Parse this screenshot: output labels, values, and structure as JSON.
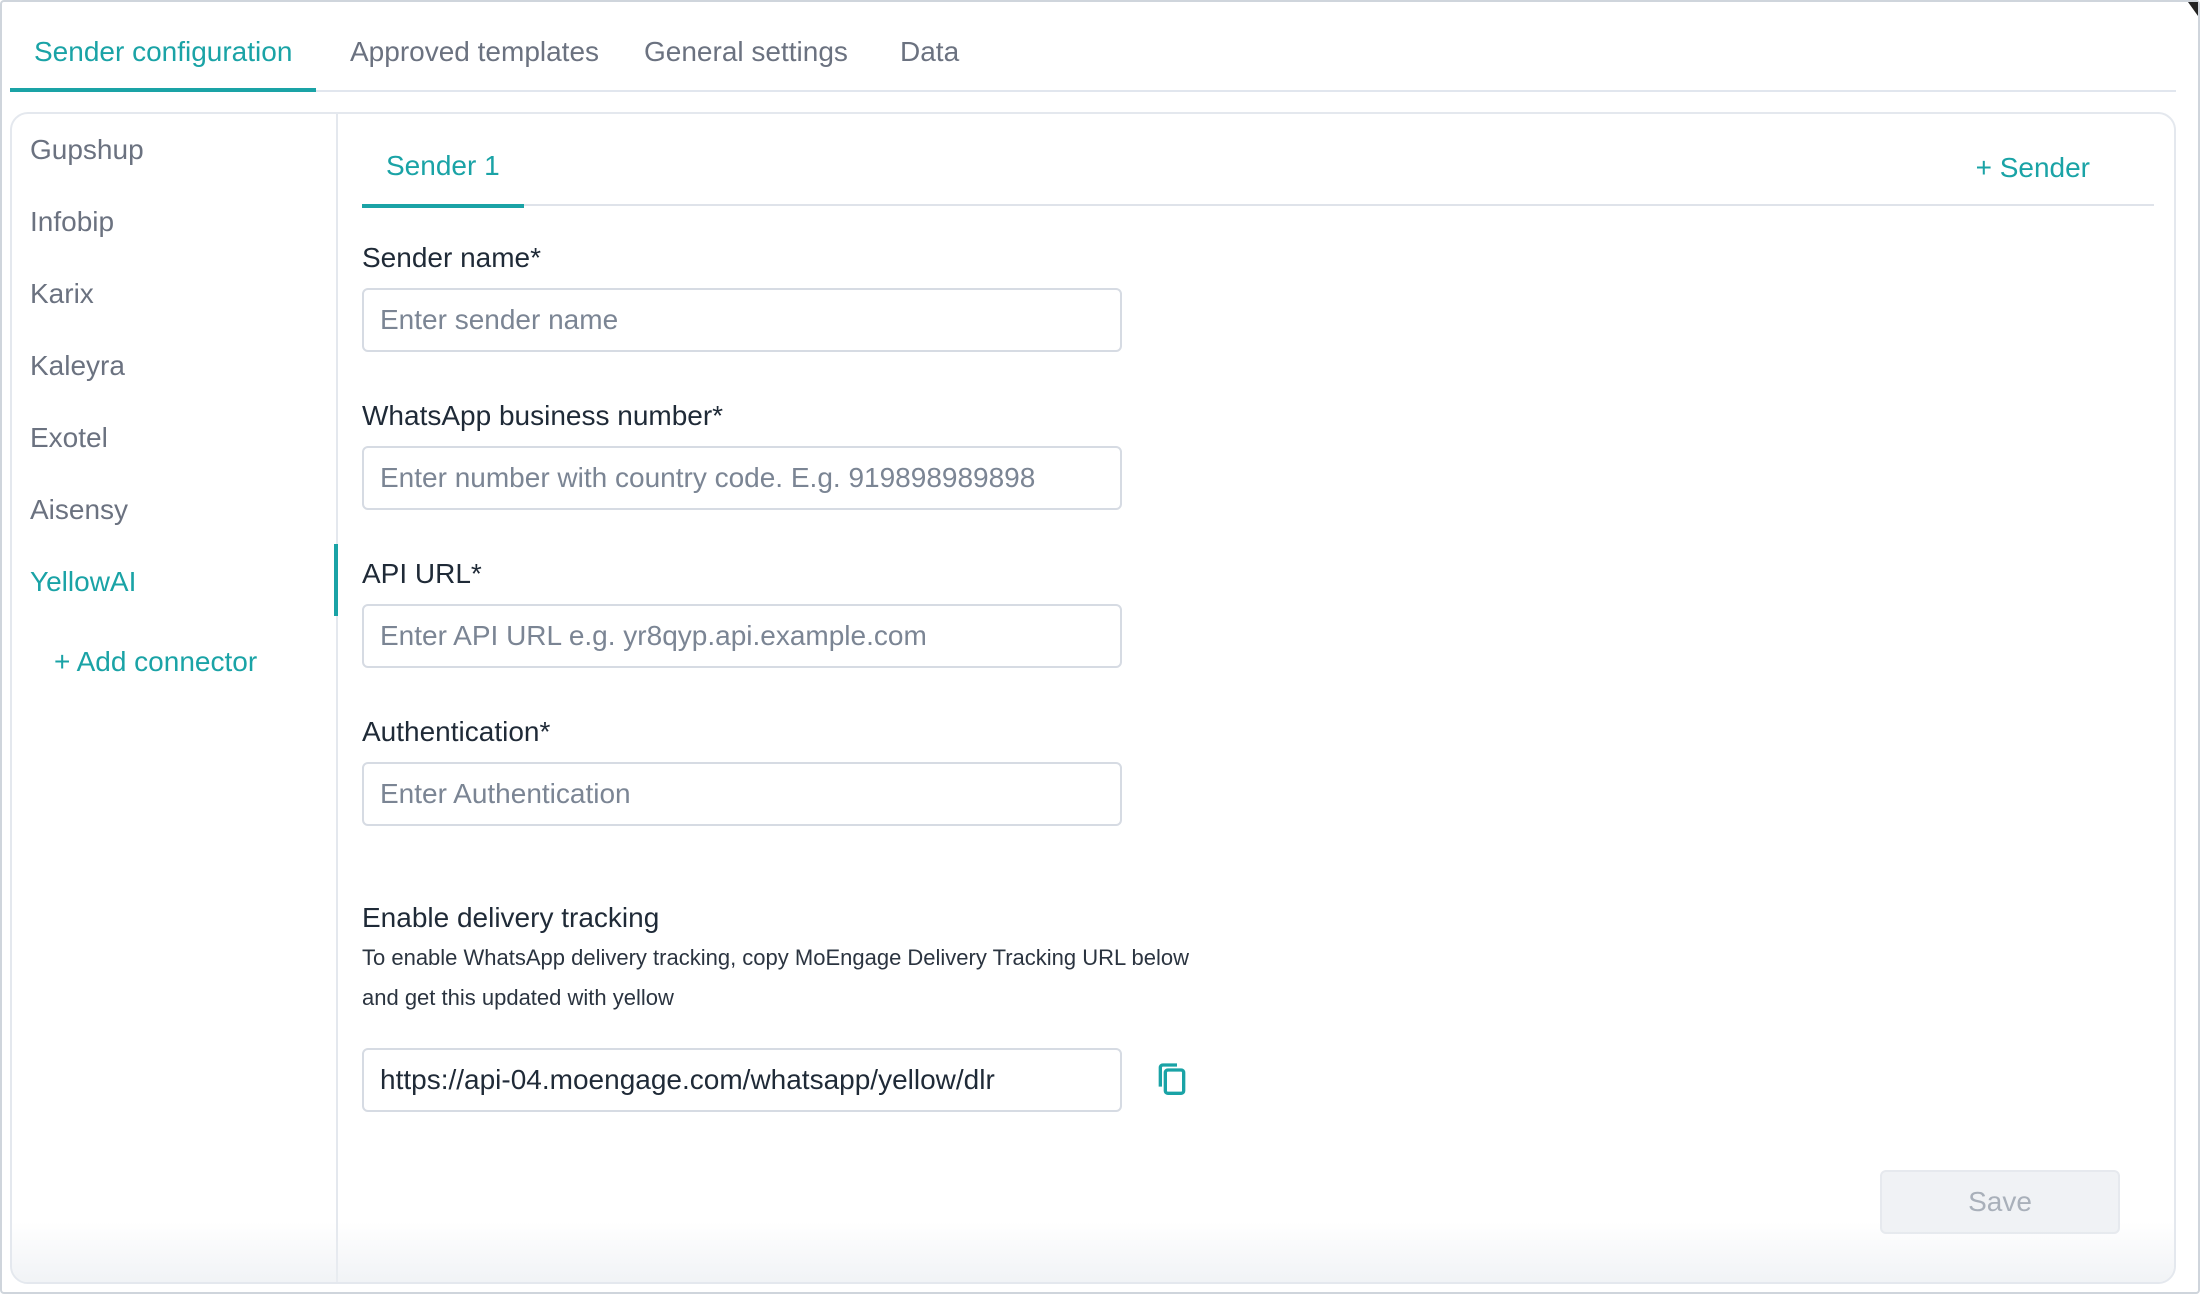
{
  "top_tabs": [
    {
      "label": "Sender configuration",
      "active": true
    },
    {
      "label": "Approved templates",
      "active": false
    },
    {
      "label": "General settings",
      "active": false
    },
    {
      "label": "Data",
      "active": false
    }
  ],
  "sidebar": {
    "items": [
      {
        "label": "Gupshup"
      },
      {
        "label": "Infobip"
      },
      {
        "label": "Karix"
      },
      {
        "label": "Kaleyra"
      },
      {
        "label": "Exotel"
      },
      {
        "label": "Aisensy"
      },
      {
        "label": "YellowAI",
        "active": true
      }
    ],
    "add_connector_label": "+ Add connector"
  },
  "sender_tabs": {
    "active_label": "Sender 1",
    "add_label": "+ Sender"
  },
  "form": {
    "sender_name": {
      "label": "Sender name*",
      "placeholder": "Enter sender name",
      "value": ""
    },
    "business_number": {
      "label": "WhatsApp business number*",
      "placeholder": "Enter number with country code. E.g. 919898989898",
      "value": ""
    },
    "api_url": {
      "label": "API URL*",
      "placeholder": "Enter API URL e.g. yr8qyp.api.example.com",
      "value": ""
    },
    "authentication": {
      "label": "Authentication*",
      "placeholder": "Enter Authentication",
      "value": ""
    }
  },
  "delivery_tracking": {
    "title": "Enable delivery tracking",
    "description_line1": "To enable WhatsApp delivery tracking, copy MoEngage Delivery Tracking URL below",
    "description_line2": "and get this updated with yellow",
    "url": "https://api-04.moengage.com/whatsapp/yellow/dlr",
    "copy_icon": "copy-icon"
  },
  "actions": {
    "save_label": "Save"
  },
  "colors": {
    "accent": "#1aa3a6",
    "muted_text": "#6b7280",
    "disabled_button": "#f0f2f5"
  }
}
